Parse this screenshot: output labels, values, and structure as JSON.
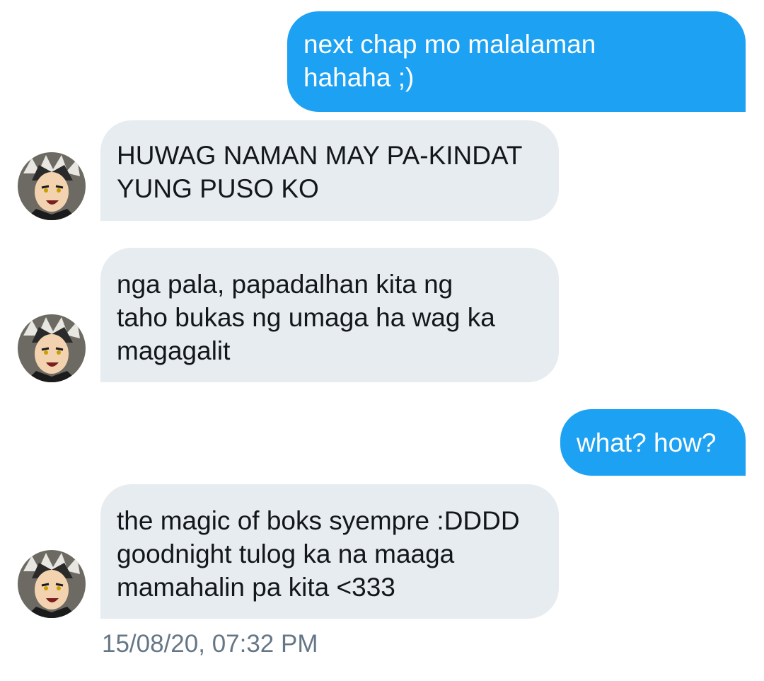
{
  "messages": [
    {
      "direction": "outgoing",
      "text": "next chap mo malalaman\nhahaha ;)"
    },
    {
      "direction": "incoming",
      "text": "HUWAG NAMAN MAY PA-KINDAT\nYUNG PUSO KO"
    },
    {
      "direction": "incoming",
      "text": "nga pala, papadalhan kita ng\ntaho bukas ng umaga ha wag ka\nmagagalit"
    },
    {
      "direction": "outgoing",
      "text": "what? how?"
    },
    {
      "direction": "incoming",
      "text": "the magic of boks syempre :DDDD\ngoodnight tulog ka na maaga\nmamahalin pa kita <333"
    }
  ],
  "timestamp": "15/08/20, 07:32 PM",
  "colors": {
    "outgoing_bubble": "#1da1f2",
    "incoming_bubble": "#e6ecf0",
    "timestamp_text": "#657786"
  },
  "icons": {
    "contact_avatar": "anime-character-avatar-icon"
  }
}
